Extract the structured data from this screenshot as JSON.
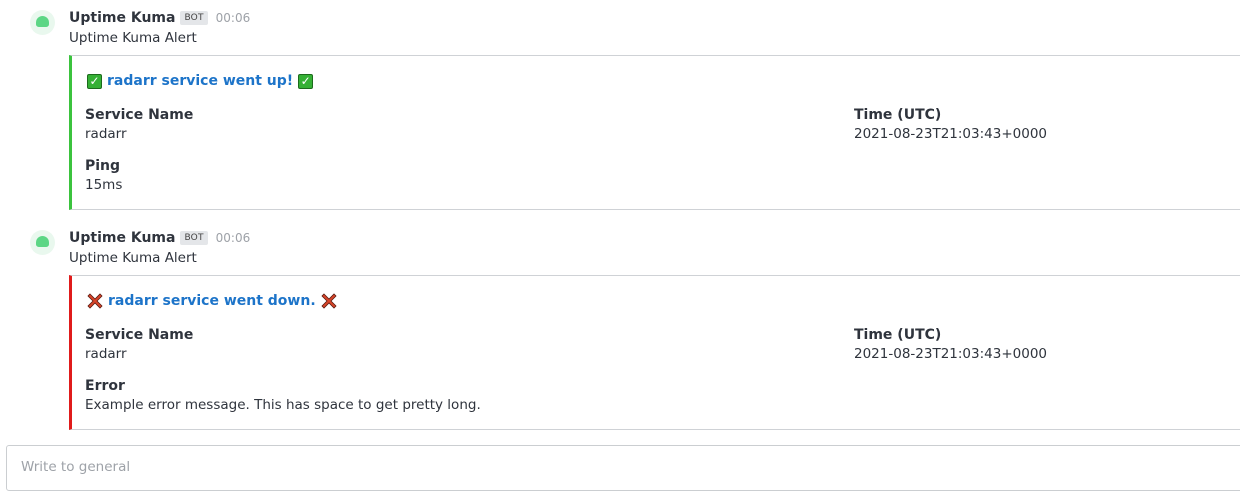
{
  "messages": [
    {
      "author": "Uptime Kuma",
      "tag": "BOT",
      "time": "00:06",
      "text": "Uptime Kuma Alert",
      "attachment": {
        "status": "up",
        "color": "#3bc33e",
        "icon": "check-emoji-icon",
        "title": "radarr service went up!",
        "fields": [
          {
            "label": "Service Name",
            "value": "radarr"
          },
          {
            "label": "Time (UTC)",
            "value": "2021-08-23T21:03:43+0000"
          },
          {
            "label": "Ping",
            "value": "15ms"
          }
        ]
      }
    },
    {
      "author": "Uptime Kuma",
      "tag": "BOT",
      "time": "00:06",
      "text": "Uptime Kuma Alert",
      "attachment": {
        "status": "down",
        "color": "#e01b1b",
        "icon": "cross-emoji-icon",
        "title": "radarr service went down.",
        "fields": [
          {
            "label": "Service Name",
            "value": "radarr"
          },
          {
            "label": "Time (UTC)",
            "value": "2021-08-23T21:03:43+0000"
          },
          {
            "label": "Error",
            "value": "Example error message. This has space to get pretty long."
          }
        ]
      }
    }
  ],
  "composer": {
    "placeholder": "Write to general"
  }
}
